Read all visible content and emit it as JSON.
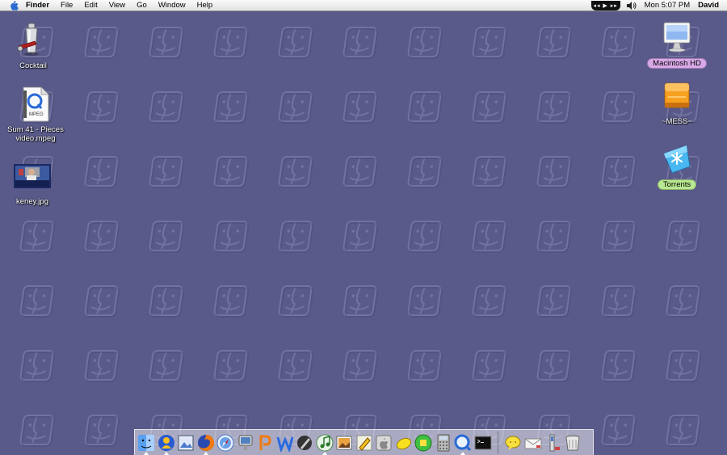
{
  "menubar": {
    "app": "Finder",
    "menus": [
      "File",
      "Edit",
      "View",
      "Go",
      "Window",
      "Help"
    ],
    "itunes_controls": "◂◂ ▶ ▸▸",
    "clock": "Mon 5:07 PM",
    "user": "David"
  },
  "desktop": {
    "background_color": "#5a5a8a",
    "left_icons": [
      {
        "label": "Cocktail",
        "icon": "cocktail-shaker-icon"
      },
      {
        "label": "Sum 41 - Pieces\nvideo.mpeg",
        "icon": "mpeg-file-icon"
      },
      {
        "label": "keney.jpg",
        "icon": "jpg-thumbnail-icon"
      }
    ],
    "right_icons": [
      {
        "label": "Macintosh HD",
        "icon": "imac-drive-icon",
        "label_color": "#d8a8e8"
      },
      {
        "label": "~MESS~",
        "icon": "orange-drive-icon"
      },
      {
        "label": "Torrents",
        "icon": "torrent-folder-icon",
        "label_color": "#b8e890"
      }
    ]
  },
  "dock": {
    "apps": [
      {
        "name": "Finder",
        "icon": "finder-icon",
        "running": true
      },
      {
        "name": "Adium",
        "icon": "adium-icon",
        "running": true
      },
      {
        "name": "Preview",
        "icon": "preview-icon",
        "running": false
      },
      {
        "name": "Firefox",
        "icon": "firefox-icon",
        "running": true
      },
      {
        "name": "Safari",
        "icon": "safari-icon",
        "running": false
      },
      {
        "name": "iChat",
        "icon": "ichat-icon",
        "running": false
      },
      {
        "name": "Pages",
        "icon": "pages-icon",
        "running": false
      },
      {
        "name": "Word",
        "icon": "word-icon",
        "running": false
      },
      {
        "name": "Script Editor",
        "icon": "pen-icon",
        "running": false
      },
      {
        "name": "iTunes",
        "icon": "itunes-icon",
        "running": true
      },
      {
        "name": "iPhoto",
        "icon": "iphoto-icon",
        "running": false
      },
      {
        "name": "Pencil",
        "icon": "pencil-icon",
        "running": false
      },
      {
        "name": "System Preferences",
        "icon": "apple-icon",
        "running": false
      },
      {
        "name": "Lemon",
        "icon": "lemon-icon",
        "running": false
      },
      {
        "name": "Butler",
        "icon": "green-app-icon",
        "running": false
      },
      {
        "name": "Calculator",
        "icon": "calculator-icon",
        "running": false
      },
      {
        "name": "QuickTime",
        "icon": "quicktime-icon",
        "running": true
      },
      {
        "name": "Terminal",
        "icon": "terminal-icon",
        "running": false
      }
    ],
    "docs": [
      {
        "name": "Chat",
        "icon": "chat-bubble-icon"
      },
      {
        "name": "Mail",
        "icon": "envelope-icon"
      },
      {
        "name": "Applications",
        "icon": "applications-folder-icon"
      },
      {
        "name": "Trash",
        "icon": "trash-icon"
      }
    ]
  }
}
